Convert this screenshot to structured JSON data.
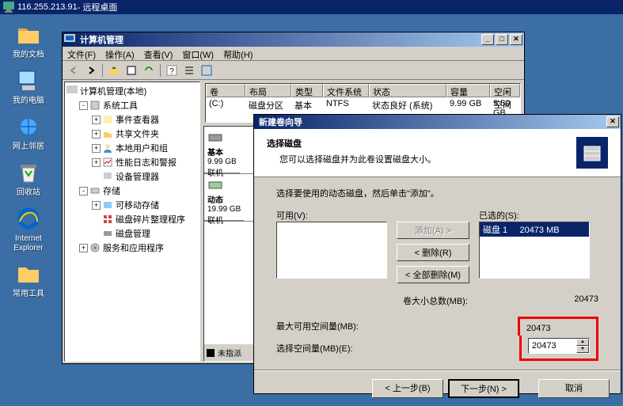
{
  "rdp": {
    "ip": "116.255.213.91",
    "label": " - 远程桌面"
  },
  "desktop_icons": [
    {
      "label": "我的文档"
    },
    {
      "label": "我的电脑"
    },
    {
      "label": "网上邻居"
    },
    {
      "label": "回收站"
    },
    {
      "label": "Internet\nExplorer"
    },
    {
      "label": "常用工具"
    }
  ],
  "mgmt": {
    "title": "计算机管理",
    "menus": [
      "文件(F)",
      "操作(A)",
      "查看(V)",
      "窗口(W)",
      "帮助(H)"
    ],
    "tree": {
      "root": "计算机管理(本地)",
      "n1": "系统工具",
      "n1c": [
        "事件查看器",
        "共享文件夹",
        "本地用户和组",
        "性能日志和警报",
        "设备管理器"
      ],
      "n2": "存储",
      "n2c": [
        "可移动存储",
        "磁盘碎片整理程序",
        "磁盘管理"
      ],
      "n3": "服务和应用程序"
    },
    "cols": [
      "卷",
      "布局",
      "类型",
      "文件系统",
      "状态",
      "容量",
      "空闲空间"
    ],
    "row": {
      "vol": "(C:)",
      "layout": "磁盘分区",
      "type": "基本",
      "fs": "NTFS",
      "status": "状态良好 (系统)",
      "cap": "9.99 GB",
      "free": "5.50 GB"
    },
    "disk0": {
      "name": "基本",
      "size": "9.99 GB",
      "status": "联机"
    },
    "disk1": {
      "name": "动态",
      "size": "19.99 GB",
      "status": "联机"
    },
    "unalloc": "未指派"
  },
  "wizard": {
    "title": "新建卷向导",
    "header_title": "选择磁盘",
    "header_sub": "您可以选择磁盘并为此卷设置磁盘大小。",
    "instruction": "选择要使用的动态磁盘，然后单击\"添加\"。",
    "avail_label": "可用(V):",
    "selected_label": "已选的(S):",
    "selected_item": "磁盘 1",
    "selected_mb": "20473 MB",
    "btn_add": "添加(A) >",
    "btn_remove": "< 删除(R)",
    "btn_remove_all": "< 全部删除(M)",
    "total_label": "卷大小总数(MB):",
    "total_value": "20473",
    "max_label": "最大可用空间量(MB):",
    "max_value": "20473",
    "sel_label": "选择空间量(MB)(E):",
    "sel_value": "20473",
    "back": "< 上一步(B)",
    "next": "下一步(N) >",
    "cancel": "取消"
  }
}
